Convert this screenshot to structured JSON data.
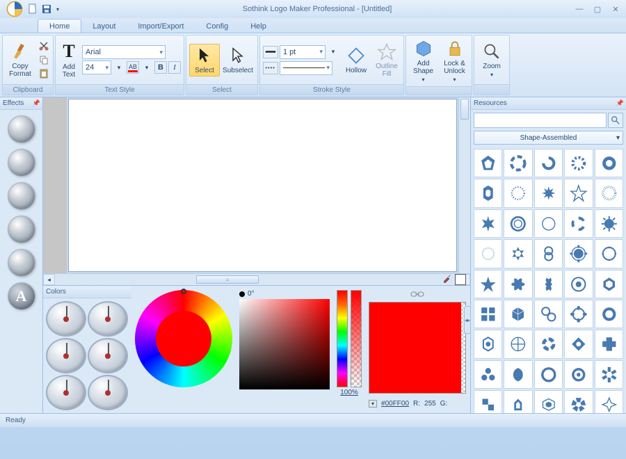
{
  "app": {
    "title": "Sothink Logo Maker Professional - [Untitled]"
  },
  "qat": {
    "new": "New",
    "save": "Save"
  },
  "tabs": [
    "Home",
    "Layout",
    "Import/Export",
    "Config",
    "Help"
  ],
  "active_tab": "Home",
  "ribbon": {
    "clipboard": {
      "label": "Clipboard",
      "copy_format": "Copy\nFormat"
    },
    "text": {
      "label": "Text Style",
      "add_text": "Add\nText",
      "font": "Arial",
      "size": "24"
    },
    "select": {
      "label": "Select",
      "select_btn": "Select",
      "subselect_btn": "Subselect"
    },
    "stroke": {
      "label": "Stroke Style",
      "width": "1 pt",
      "hollow": "Hollow",
      "outline_fill": "Outline\nFill"
    },
    "shape": {
      "add_shape": "Add\nShape",
      "lock": "Lock &\nUnlock"
    },
    "zoom": {
      "label": "Zoom"
    }
  },
  "panels": {
    "effects": "Effects",
    "resources": "Resources",
    "colors": "Colors"
  },
  "resources": {
    "search_placeholder": "",
    "category": "Shape-Assembled"
  },
  "colors": {
    "angle": "0°",
    "opacity": "100%",
    "hex": "#00FF00",
    "r_label": "R:",
    "r_value": "255",
    "g_label": "G:"
  },
  "status": "Ready"
}
